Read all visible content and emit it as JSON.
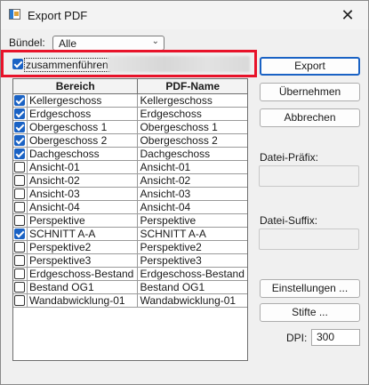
{
  "window": {
    "title": "Export PDF",
    "close_glyph": "✕"
  },
  "bundle": {
    "label": "Bündel:",
    "value": "Alle"
  },
  "merge": {
    "label": "zusammenführen",
    "checked": true
  },
  "buttons": {
    "export": "Export",
    "apply": "Übernehmen",
    "cancel": "Abbrechen",
    "settings": "Einstellungen ...",
    "pens": "Stifte ..."
  },
  "table": {
    "headers": {
      "area": "Bereich",
      "pdf_name": "PDF-Name"
    },
    "rows": [
      {
        "checked": true,
        "area": "Kellergeschoss",
        "pdf_name": "Kellergeschoss"
      },
      {
        "checked": true,
        "area": "Erdgeschoss",
        "pdf_name": "Erdgeschoss"
      },
      {
        "checked": true,
        "area": "Obergeschoss 1",
        "pdf_name": "Obergeschoss 1"
      },
      {
        "checked": true,
        "area": "Obergeschoss 2",
        "pdf_name": "Obergeschoss 2"
      },
      {
        "checked": true,
        "area": "Dachgeschoss",
        "pdf_name": "Dachgeschoss"
      },
      {
        "checked": false,
        "area": "Ansicht-01",
        "pdf_name": "Ansicht-01"
      },
      {
        "checked": false,
        "area": "Ansicht-02",
        "pdf_name": "Ansicht-02"
      },
      {
        "checked": false,
        "area": "Ansicht-03",
        "pdf_name": "Ansicht-03"
      },
      {
        "checked": false,
        "area": "Ansicht-04",
        "pdf_name": "Ansicht-04"
      },
      {
        "checked": false,
        "area": "Perspektive",
        "pdf_name": "Perspektive"
      },
      {
        "checked": true,
        "area": "SCHNITT A-A",
        "pdf_name": "SCHNITT A-A"
      },
      {
        "checked": false,
        "area": "Perspektive2",
        "pdf_name": "Perspektive2"
      },
      {
        "checked": false,
        "area": "Perspektive3",
        "pdf_name": "Perspektive3"
      },
      {
        "checked": false,
        "area": "Erdgeschoss-Bestand",
        "pdf_name": "Erdgeschoss-Bestand"
      },
      {
        "checked": false,
        "area": "Bestand OG1",
        "pdf_name": "Bestand OG1"
      },
      {
        "checked": false,
        "area": "Wandabwicklung-01",
        "pdf_name": "Wandabwicklung-01"
      }
    ]
  },
  "prefix": {
    "label": "Datei-Präfix:",
    "value": ""
  },
  "suffix": {
    "label": "Datei-Suffix:",
    "value": ""
  },
  "dpi": {
    "label": "DPI:",
    "value": "300"
  },
  "colors": {
    "accent": "#1a62c4",
    "highlight": "#e8132a"
  },
  "icons": {
    "app": "pdf-export-icon",
    "close": "close-icon",
    "chevron": "chevron-down-icon"
  }
}
